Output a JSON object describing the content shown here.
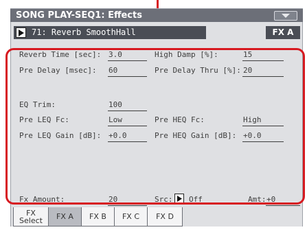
{
  "window": {
    "title": "SONG PLAY-SEQ1: Effects"
  },
  "effect": {
    "selected": "71: Reverb SmoothHall",
    "fx_block": "FX A"
  },
  "params": {
    "reverb_time": {
      "label": "Reverb Time [sec]:",
      "value": "3.0"
    },
    "high_damp": {
      "label": "High Damp [%]:",
      "value": "15"
    },
    "pre_delay": {
      "label": "Pre Delay [msec]:",
      "value": "60"
    },
    "pre_delay_thru": {
      "label": "Pre Delay Thru [%]:",
      "value": "20"
    },
    "eq_trim": {
      "label": "EQ Trim:",
      "value": "100"
    },
    "pre_leq_fc": {
      "label": "Pre LEQ Fc:",
      "value": "Low"
    },
    "pre_heq_fc": {
      "label": "Pre HEQ Fc:",
      "value": "High"
    },
    "pre_leq_gain": {
      "label": "Pre LEQ Gain [dB]:",
      "value": "+0.0"
    },
    "pre_heq_gain": {
      "label": "Pre HEQ Gain [dB]:",
      "value": "+0.0"
    },
    "fx_amount": {
      "label": "Fx Amount:",
      "value": "20"
    },
    "src": {
      "label": "Src:",
      "value": "Off"
    },
    "amt": {
      "label": "Amt:",
      "value": "+0"
    }
  },
  "tabs": [
    {
      "label_line1": "FX",
      "label_line2": "Select"
    },
    {
      "label": "FX A"
    },
    {
      "label": "FX B"
    },
    {
      "label": "FX C"
    },
    {
      "label": "FX D"
    }
  ],
  "colors": {
    "highlight": "#d71920",
    "title_bg": "#6c6f78",
    "panel_bg": "#dfe0e3",
    "active_tab": "#b9bbc1"
  },
  "icons": {
    "menu": "chevron-down-icon",
    "play": "play-triangle-icon"
  }
}
